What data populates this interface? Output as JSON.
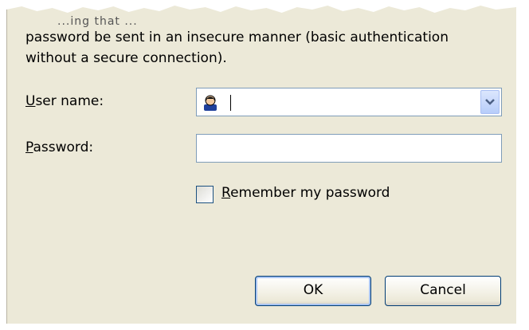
{
  "message": {
    "line0": "...ing that ...",
    "line1": "password be sent in an insecure manner (basic authentication",
    "line2": "without a secure connection)."
  },
  "username": {
    "label_accel": "U",
    "label_rest": "ser name:",
    "value": ""
  },
  "password": {
    "label_accel": "P",
    "label_rest": "assword:",
    "value": ""
  },
  "remember": {
    "label_accel": "R",
    "label_rest": "emember my password",
    "checked": false
  },
  "buttons": {
    "ok": "OK",
    "cancel": "Cancel"
  },
  "icons": {
    "user": "user-icon",
    "dropdown": "chevron-down-icon"
  }
}
